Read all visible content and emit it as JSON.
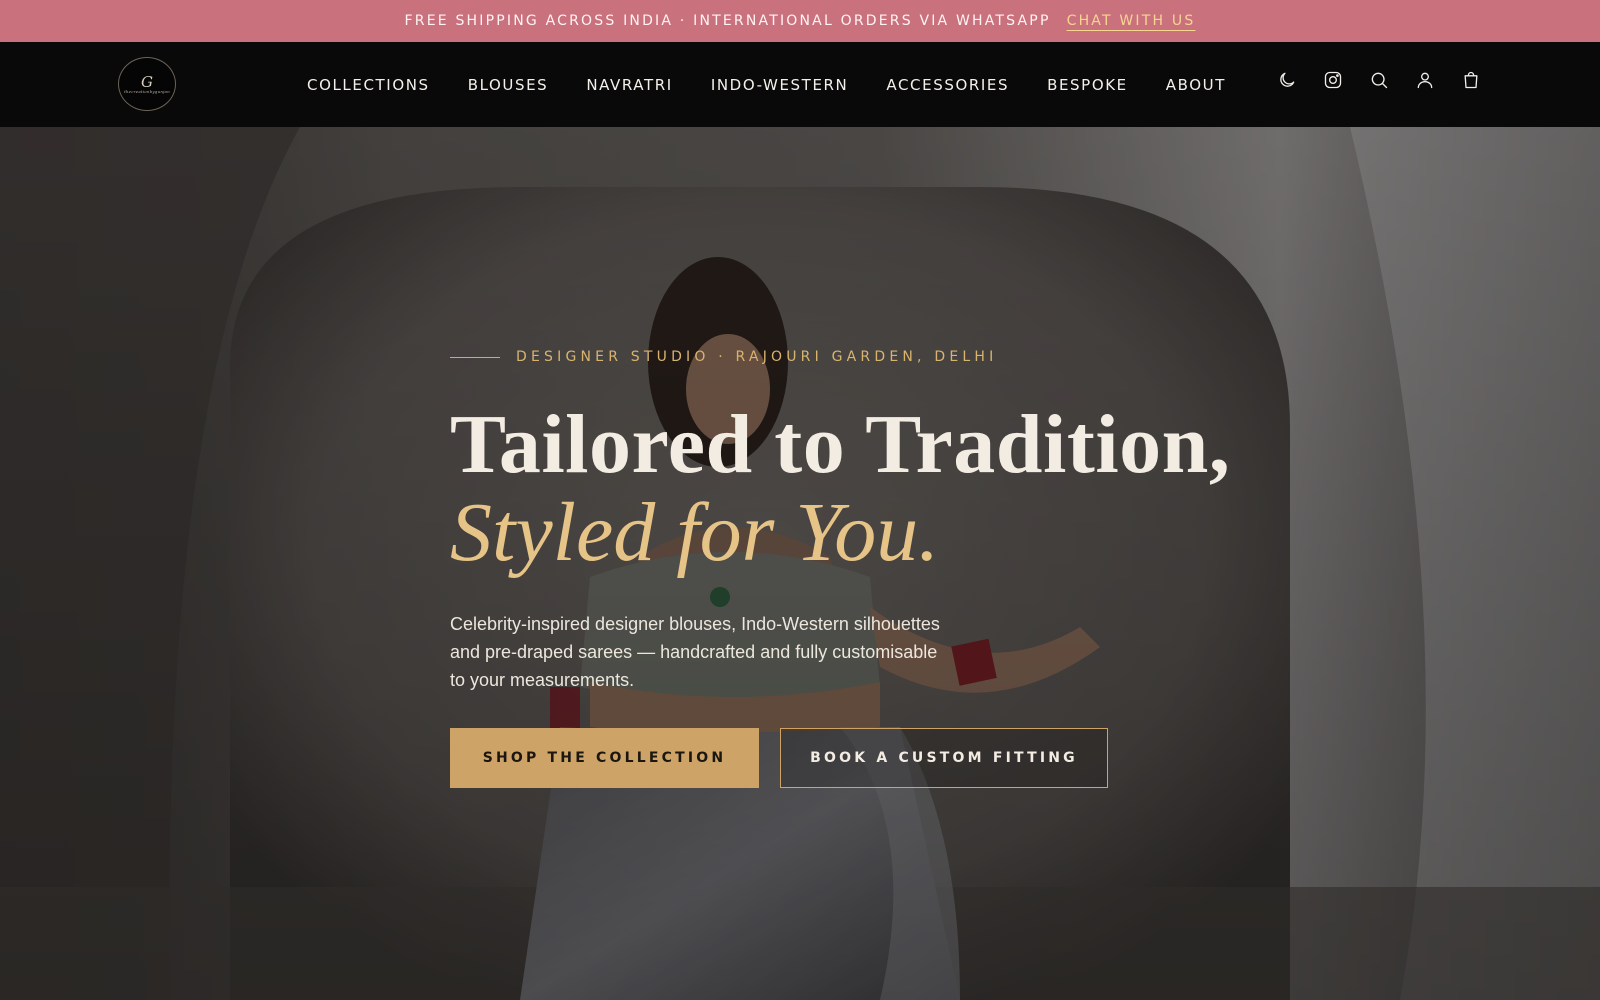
{
  "colors": {
    "announce_bg": "#c9727e",
    "header_bg": "#0a0909",
    "accent_gold": "#cda367",
    "hero_heading": "#f3ece3",
    "hero_italic": "#e6c387"
  },
  "announcement": {
    "text": "FREE SHIPPING ACROSS INDIA · INTERNATIONAL ORDERS VIA WHATSAPP",
    "link": "CHAT WITH US"
  },
  "header": {
    "logo_mark": "G",
    "logo_script": "thecreationbygunjan",
    "nav": [
      {
        "label": "COLLECTIONS"
      },
      {
        "label": "BLOUSES"
      },
      {
        "label": "NAVRATRI"
      },
      {
        "label": "INDO-WESTERN"
      },
      {
        "label": "ACCESSORIES"
      },
      {
        "label": "BESPOKE"
      },
      {
        "label": "ABOUT"
      }
    ],
    "icons": [
      "moon-icon",
      "instagram-icon",
      "search-icon",
      "user-icon",
      "bag-icon"
    ]
  },
  "hero": {
    "eyebrow": "DESIGNER STUDIO · RAJOURI GARDEN, DELHI",
    "title_line1": "Tailored to Tradition,",
    "title_line2": "Styled for You.",
    "subtitle": "Celebrity-inspired designer blouses, Indo-Western silhouettes and pre-draped sarees — handcrafted and fully customisable to your measurements.",
    "primary_cta": "SHOP THE COLLECTION",
    "secondary_cta": "BOOK A CUSTOM FITTING"
  }
}
